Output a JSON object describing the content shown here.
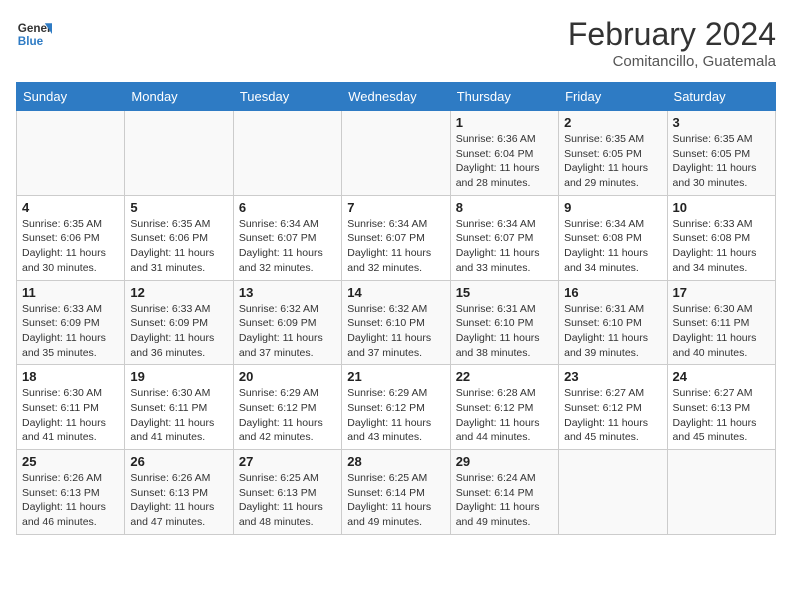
{
  "header": {
    "logo_line1": "General",
    "logo_line2": "Blue",
    "title": "February 2024",
    "subtitle": "Comitancillo, Guatemala"
  },
  "weekdays": [
    "Sunday",
    "Monday",
    "Tuesday",
    "Wednesday",
    "Thursday",
    "Friday",
    "Saturday"
  ],
  "weeks": [
    [
      {
        "day": "",
        "info": ""
      },
      {
        "day": "",
        "info": ""
      },
      {
        "day": "",
        "info": ""
      },
      {
        "day": "",
        "info": ""
      },
      {
        "day": "1",
        "info": "Sunrise: 6:36 AM\nSunset: 6:04 PM\nDaylight: 11 hours and 28 minutes."
      },
      {
        "day": "2",
        "info": "Sunrise: 6:35 AM\nSunset: 6:05 PM\nDaylight: 11 hours and 29 minutes."
      },
      {
        "day": "3",
        "info": "Sunrise: 6:35 AM\nSunset: 6:05 PM\nDaylight: 11 hours and 30 minutes."
      }
    ],
    [
      {
        "day": "4",
        "info": "Sunrise: 6:35 AM\nSunset: 6:06 PM\nDaylight: 11 hours and 30 minutes."
      },
      {
        "day": "5",
        "info": "Sunrise: 6:35 AM\nSunset: 6:06 PM\nDaylight: 11 hours and 31 minutes."
      },
      {
        "day": "6",
        "info": "Sunrise: 6:34 AM\nSunset: 6:07 PM\nDaylight: 11 hours and 32 minutes."
      },
      {
        "day": "7",
        "info": "Sunrise: 6:34 AM\nSunset: 6:07 PM\nDaylight: 11 hours and 32 minutes."
      },
      {
        "day": "8",
        "info": "Sunrise: 6:34 AM\nSunset: 6:07 PM\nDaylight: 11 hours and 33 minutes."
      },
      {
        "day": "9",
        "info": "Sunrise: 6:34 AM\nSunset: 6:08 PM\nDaylight: 11 hours and 34 minutes."
      },
      {
        "day": "10",
        "info": "Sunrise: 6:33 AM\nSunset: 6:08 PM\nDaylight: 11 hours and 34 minutes."
      }
    ],
    [
      {
        "day": "11",
        "info": "Sunrise: 6:33 AM\nSunset: 6:09 PM\nDaylight: 11 hours and 35 minutes."
      },
      {
        "day": "12",
        "info": "Sunrise: 6:33 AM\nSunset: 6:09 PM\nDaylight: 11 hours and 36 minutes."
      },
      {
        "day": "13",
        "info": "Sunrise: 6:32 AM\nSunset: 6:09 PM\nDaylight: 11 hours and 37 minutes."
      },
      {
        "day": "14",
        "info": "Sunrise: 6:32 AM\nSunset: 6:10 PM\nDaylight: 11 hours and 37 minutes."
      },
      {
        "day": "15",
        "info": "Sunrise: 6:31 AM\nSunset: 6:10 PM\nDaylight: 11 hours and 38 minutes."
      },
      {
        "day": "16",
        "info": "Sunrise: 6:31 AM\nSunset: 6:10 PM\nDaylight: 11 hours and 39 minutes."
      },
      {
        "day": "17",
        "info": "Sunrise: 6:30 AM\nSunset: 6:11 PM\nDaylight: 11 hours and 40 minutes."
      }
    ],
    [
      {
        "day": "18",
        "info": "Sunrise: 6:30 AM\nSunset: 6:11 PM\nDaylight: 11 hours and 41 minutes."
      },
      {
        "day": "19",
        "info": "Sunrise: 6:30 AM\nSunset: 6:11 PM\nDaylight: 11 hours and 41 minutes."
      },
      {
        "day": "20",
        "info": "Sunrise: 6:29 AM\nSunset: 6:12 PM\nDaylight: 11 hours and 42 minutes."
      },
      {
        "day": "21",
        "info": "Sunrise: 6:29 AM\nSunset: 6:12 PM\nDaylight: 11 hours and 43 minutes."
      },
      {
        "day": "22",
        "info": "Sunrise: 6:28 AM\nSunset: 6:12 PM\nDaylight: 11 hours and 44 minutes."
      },
      {
        "day": "23",
        "info": "Sunrise: 6:27 AM\nSunset: 6:12 PM\nDaylight: 11 hours and 45 minutes."
      },
      {
        "day": "24",
        "info": "Sunrise: 6:27 AM\nSunset: 6:13 PM\nDaylight: 11 hours and 45 minutes."
      }
    ],
    [
      {
        "day": "25",
        "info": "Sunrise: 6:26 AM\nSunset: 6:13 PM\nDaylight: 11 hours and 46 minutes."
      },
      {
        "day": "26",
        "info": "Sunrise: 6:26 AM\nSunset: 6:13 PM\nDaylight: 11 hours and 47 minutes."
      },
      {
        "day": "27",
        "info": "Sunrise: 6:25 AM\nSunset: 6:13 PM\nDaylight: 11 hours and 48 minutes."
      },
      {
        "day": "28",
        "info": "Sunrise: 6:25 AM\nSunset: 6:14 PM\nDaylight: 11 hours and 49 minutes."
      },
      {
        "day": "29",
        "info": "Sunrise: 6:24 AM\nSunset: 6:14 PM\nDaylight: 11 hours and 49 minutes."
      },
      {
        "day": "",
        "info": ""
      },
      {
        "day": "",
        "info": ""
      }
    ]
  ]
}
